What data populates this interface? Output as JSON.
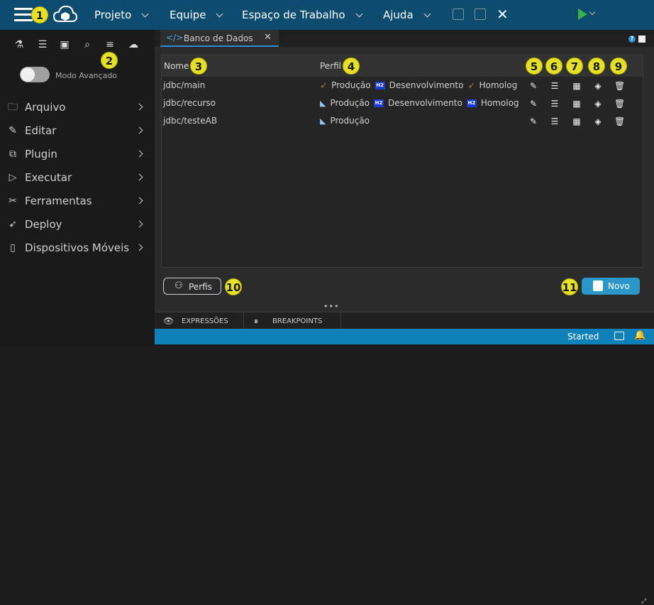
{
  "header": {
    "menus": [
      {
        "label": "Projeto"
      },
      {
        "label": "Equipe"
      },
      {
        "label": "Espaço de Trabalho"
      },
      {
        "label": "Ajuda"
      }
    ],
    "icons": [
      "hamburger-icon",
      "cloud-logo-icon",
      "save-icon",
      "save-all-icon",
      "close-icon",
      "run-icon",
      "chevron-down-icon"
    ]
  },
  "annotations": [
    "1",
    "2",
    "3",
    "4",
    "5",
    "6",
    "7",
    "8",
    "9",
    "10",
    "11"
  ],
  "sidebar": {
    "tool_icons": [
      "flask-icon",
      "checklist-icon",
      "terminal-icon",
      "search-file-icon",
      "database-icon",
      "cloud-service-icon"
    ],
    "toggle_label": "Modo Avançado",
    "items": [
      {
        "label": "Arquivo",
        "icon": "folder-icon"
      },
      {
        "label": "Editar",
        "icon": "pencil-icon"
      },
      {
        "label": "Plugin",
        "icon": "plugin-icon"
      },
      {
        "label": "Executar",
        "icon": "play-icon"
      },
      {
        "label": "Ferramentas",
        "icon": "tools-icon"
      },
      {
        "label": "Deploy",
        "icon": "rocket-icon"
      },
      {
        "label": "Dispositivos Móveis",
        "icon": "mobile-icon"
      }
    ]
  },
  "tab": {
    "label": "Banco de Dados"
  },
  "table": {
    "headers": {
      "name": "Nome",
      "profile": "Perfil"
    },
    "rows": [
      {
        "name": "jdbc/main",
        "profiles": [
          {
            "icon": "rocket-icon",
            "label": "Produção"
          },
          {
            "icon": "h2-icon",
            "badge": "H2",
            "label": "Desenvolvimento"
          },
          {
            "icon": "rocket-icon",
            "label": "Homolog"
          }
        ]
      },
      {
        "name": "jdbc/recurso",
        "profiles": [
          {
            "icon": "dev-icon",
            "label": "Produção"
          },
          {
            "icon": "h2-icon",
            "badge": "H2",
            "label": "Desenvolvimento"
          },
          {
            "icon": "h2-icon",
            "badge": "H2",
            "label": "Homolog"
          }
        ]
      },
      {
        "name": "jdbc/testeAB",
        "profiles": [
          {
            "icon": "dev-icon",
            "label": "Produção"
          }
        ]
      }
    ],
    "action_icons": [
      "edit-icon",
      "database-settings-icon",
      "excel-icon",
      "layers-icon",
      "trash-icon"
    ]
  },
  "buttons": {
    "profiles": "Perfis",
    "new": "Novo"
  },
  "bottom_tabs": [
    {
      "label": "EXPRESSÕES",
      "icon": "eye-icon"
    },
    {
      "label": "BREAKPOINTS",
      "icon": "pause-icon"
    }
  ],
  "status": {
    "text": "Started"
  },
  "colors": {
    "header_bg": "#0e4c6f",
    "accent": "#2b97c9",
    "status_bg": "#0e82b8",
    "annotation": "#e7e02a"
  }
}
